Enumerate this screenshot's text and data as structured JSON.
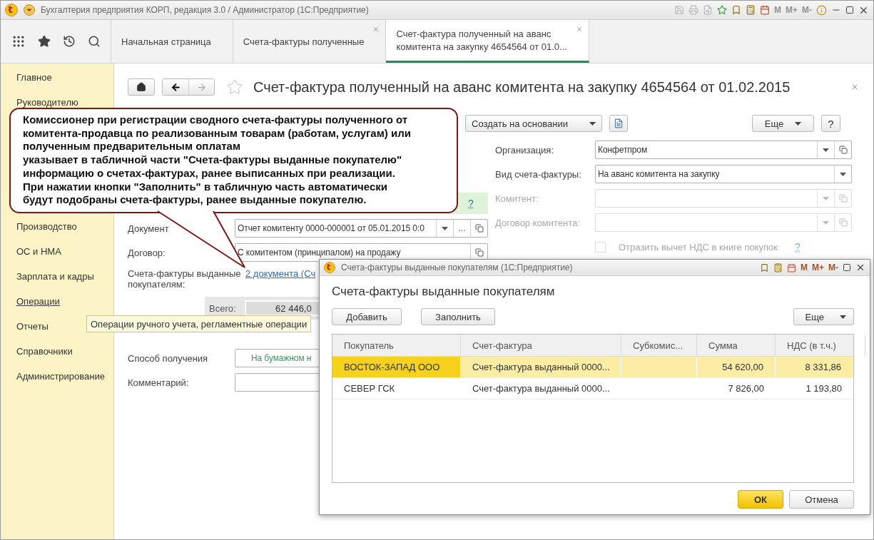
{
  "window": {
    "title": "Бухгалтерия предприятия КОРП, редакция 3.0 / Администратор  (1С:Предприятие)",
    "memory_buttons": [
      "M",
      "M+",
      "M-"
    ]
  },
  "tabs": [
    {
      "label": "Начальная страница",
      "selected": false,
      "closable": false
    },
    {
      "label": "Счета-фактуры полученные",
      "selected": false,
      "closable": true
    },
    {
      "label": "Счет-фактура полученный на аванс комитента на закупку 4654564 от 01.0...",
      "selected": true,
      "closable": true
    }
  ],
  "sidebar": {
    "top_items": [
      {
        "label": "Главное",
        "hovered": false
      },
      {
        "label": "Руководителю",
        "hovered": false
      }
    ],
    "items": [
      {
        "label": "Производство",
        "hovered": false
      },
      {
        "label": "ОС и НМА",
        "hovered": false
      },
      {
        "label": "Зарплата и кадры",
        "hovered": false
      },
      {
        "label": "Операции",
        "hovered": true
      },
      {
        "label": "Отчеты",
        "hovered": false
      },
      {
        "label": "Справочники",
        "hovered": false
      },
      {
        "label": "Администрирование",
        "hovered": false
      }
    ]
  },
  "document": {
    "title": "Счет-фактура полученный на аванс комитента на закупку 4654564 от 01.02.2015",
    "toolbar": {
      "create_based_on": "Создать на основании",
      "more": "Еще",
      "help": "?"
    },
    "hint_help": "?",
    "right_fields": [
      {
        "label": "Организация:",
        "value": "Конфетпром",
        "disabled": false,
        "open_button": true
      },
      {
        "label": "Вид счета-фактуры:",
        "value": "На аванс комитента на закупку",
        "disabled": false,
        "open_button": false
      },
      {
        "label": "Комитент:",
        "disabled": true,
        "open_button": true
      },
      {
        "label": "Договор комитента:",
        "disabled": true,
        "open_button": true
      }
    ],
    "vat_deduction": {
      "label": "Отразить вычет НДС в книге покупок",
      "checked": false,
      "disabled": true,
      "help": "?"
    },
    "base_document": {
      "label": "Документ",
      "value": "Отчет комитенту 0000-000001 от 05.01.2015 0:0",
      "select_button": "..."
    },
    "contract": {
      "label": "Договор:",
      "value": "С комитентом (принципалом) на продажу"
    },
    "invoices_issued": {
      "label": "Счета-фактуры выданные покупателям:",
      "link": "2 документа (Сч"
    },
    "total": {
      "label": "Всего:",
      "value": "62 446,0"
    },
    "receipt_method": {
      "label": "Способ получения",
      "value": "На бумажном н"
    },
    "comment": {
      "label": "Комментарий:"
    }
  },
  "callout": {
    "lines": [
      "Комиссионер при регистрации сводного счета-фактуры полученного от",
      "комитента-продавца по реализованным товарам (работам, услугам) или",
      "полученным предварительным оплатам",
      "указывает в табличной части \"Счета-фактуры выданные покупателю\"",
      "информацию о счетах-фактурах, ранее выписанных при реализации.",
      "При нажатии кнопки \"Заполнить\" в табличную часть автоматически",
      "будут подобраны счета-фактуры, ранее выданные покупателю."
    ]
  },
  "tooltip": {
    "text": "Операции ручного учета, регламентные операции"
  },
  "dialog": {
    "title": "Счета-фактуры выданные покупателям  (1С:Предприятие)",
    "memory_buttons": [
      "M",
      "M+",
      "M-"
    ],
    "heading": "Счета-фактуры выданные покупателям",
    "buttons": [
      "Добавить",
      "Заполнить"
    ],
    "more": "Еще",
    "columns": [
      {
        "label": "Покупатель",
        "kind": "text"
      },
      {
        "label": "Счет-фактура",
        "kind": "text"
      },
      {
        "label": "Субкомис...",
        "kind": "text"
      },
      {
        "label": "Сумма",
        "kind": "number"
      },
      {
        "label": "НДС (в т.ч.)",
        "kind": "number"
      }
    ],
    "rows": [
      {
        "cells": [
          "ВОСТОК-ЗАПАД ООО",
          "Счет-фактура выданный 0000...",
          null,
          "54 620,00",
          "8 331,86"
        ],
        "selected": true
      },
      {
        "cells": [
          "СЕВЕР ГСК",
          "Счет-фактура выданный 0000...",
          null,
          "7 826,00",
          "1 193,80"
        ],
        "selected": false
      }
    ],
    "ok": "ОК",
    "cancel": "Отмена"
  }
}
